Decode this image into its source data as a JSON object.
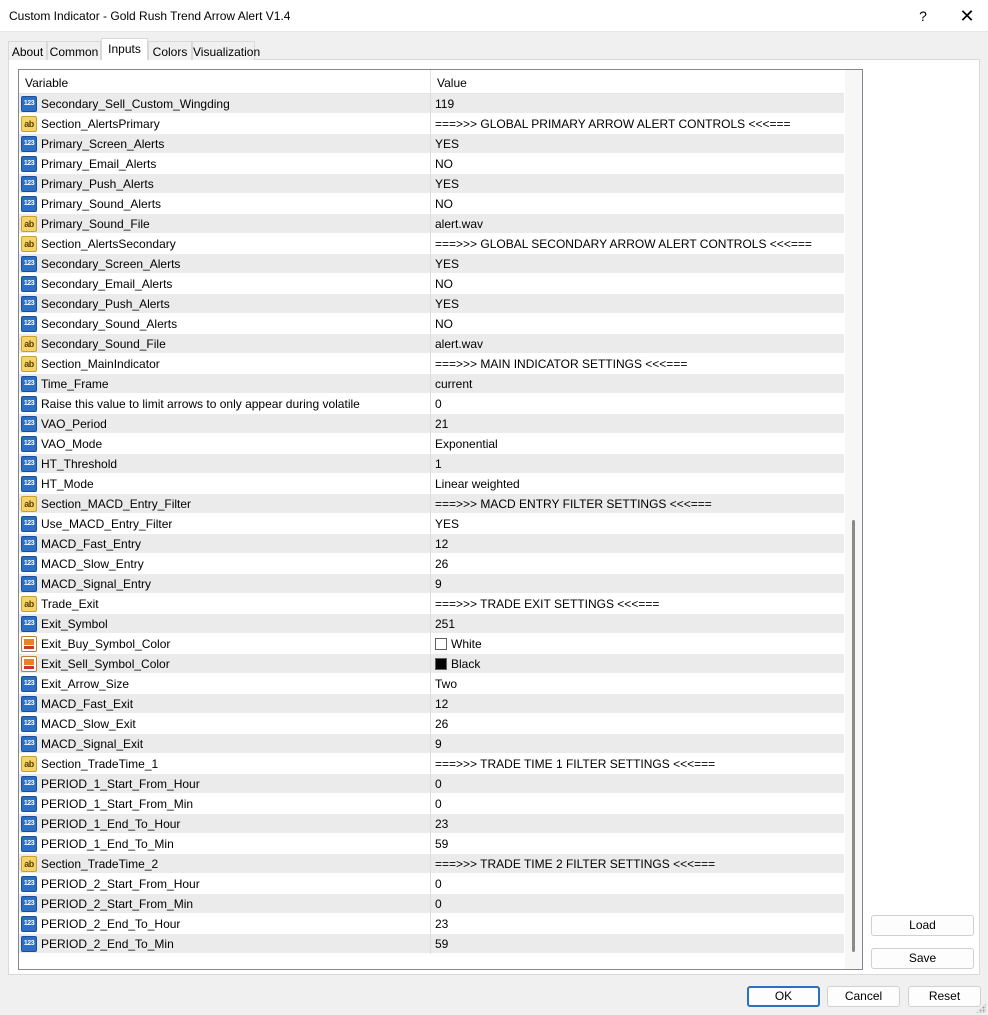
{
  "window": {
    "title": "Custom Indicator - Gold Rush Trend Arrow Alert V1.4",
    "help_label": "?",
    "close_label": "✕"
  },
  "tabs": [
    {
      "label": "About"
    },
    {
      "label": "Common"
    },
    {
      "label": "Inputs"
    },
    {
      "label": "Colors"
    },
    {
      "label": "Visualization"
    }
  ],
  "active_tab": "Inputs",
  "grid": {
    "header_variable": "Variable",
    "header_value": "Value"
  },
  "rows": [
    {
      "type": "num",
      "icon_text": "123",
      "variable": "Secondary_Sell_Custom_Wingding",
      "value": "119"
    },
    {
      "type": "str",
      "icon_text": "ab",
      "variable": "Section_AlertsPrimary",
      "value": "===>>> GLOBAL PRIMARY ARROW ALERT CONTROLS <<<==="
    },
    {
      "type": "num",
      "icon_text": "123",
      "variable": "Primary_Screen_Alerts",
      "value": "YES"
    },
    {
      "type": "num",
      "icon_text": "123",
      "variable": "Primary_Email_Alerts",
      "value": "NO"
    },
    {
      "type": "num",
      "icon_text": "123",
      "variable": "Primary_Push_Alerts",
      "value": "YES"
    },
    {
      "type": "num",
      "icon_text": "123",
      "variable": "Primary_Sound_Alerts",
      "value": "NO"
    },
    {
      "type": "str",
      "icon_text": "ab",
      "variable": "Primary_Sound_File",
      "value": "alert.wav"
    },
    {
      "type": "str",
      "icon_text": "ab",
      "variable": "Section_AlertsSecondary",
      "value": "===>>> GLOBAL SECONDARY ARROW ALERT CONTROLS <<<==="
    },
    {
      "type": "num",
      "icon_text": "123",
      "variable": "Secondary_Screen_Alerts",
      "value": "YES"
    },
    {
      "type": "num",
      "icon_text": "123",
      "variable": "Secondary_Email_Alerts",
      "value": "NO"
    },
    {
      "type": "num",
      "icon_text": "123",
      "variable": "Secondary_Push_Alerts",
      "value": "YES"
    },
    {
      "type": "num",
      "icon_text": "123",
      "variable": "Secondary_Sound_Alerts",
      "value": "NO"
    },
    {
      "type": "str",
      "icon_text": "ab",
      "variable": "Secondary_Sound_File",
      "value": "alert.wav"
    },
    {
      "type": "str",
      "icon_text": "ab",
      "variable": "Section_MainIndicator",
      "value": "===>>> MAIN INDICATOR SETTINGS <<<==="
    },
    {
      "type": "num",
      "icon_text": "123",
      "variable": "Time_Frame",
      "value": "current"
    },
    {
      "type": "num",
      "icon_text": "123",
      "variable": "Raise this value to limit arrows to only appear during volatile",
      "value": "0"
    },
    {
      "type": "num",
      "icon_text": "123",
      "variable": "VAO_Period",
      "value": "21"
    },
    {
      "type": "num",
      "icon_text": "123",
      "variable": "VAO_Mode",
      "value": "Exponential"
    },
    {
      "type": "num",
      "icon_text": "123",
      "variable": "HT_Threshold",
      "value": "1"
    },
    {
      "type": "num",
      "icon_text": "123",
      "variable": "HT_Mode",
      "value": "Linear weighted"
    },
    {
      "type": "str",
      "icon_text": "ab",
      "variable": "Section_MACD_Entry_Filter",
      "value": "===>>> MACD ENTRY FILTER SETTINGS <<<==="
    },
    {
      "type": "num",
      "icon_text": "123",
      "variable": "Use_MACD_Entry_Filter",
      "value": "YES"
    },
    {
      "type": "num",
      "icon_text": "123",
      "variable": "MACD_Fast_Entry",
      "value": "12"
    },
    {
      "type": "num",
      "icon_text": "123",
      "variable": "MACD_Slow_Entry",
      "value": "26"
    },
    {
      "type": "num",
      "icon_text": "123",
      "variable": "MACD_Signal_Entry",
      "value": "9"
    },
    {
      "type": "str",
      "icon_text": "ab",
      "variable": "Trade_Exit",
      "value": "===>>> TRADE EXIT SETTINGS <<<==="
    },
    {
      "type": "num",
      "icon_text": "123",
      "variable": "Exit_Symbol",
      "value": "251"
    },
    {
      "type": "color",
      "icon_text": "",
      "variable": "Exit_Buy_Symbol_Color",
      "value": "White",
      "swatch": "#ffffff"
    },
    {
      "type": "color",
      "icon_text": "",
      "variable": "Exit_Sell_Symbol_Color",
      "value": "Black",
      "swatch": "#000000"
    },
    {
      "type": "num",
      "icon_text": "123",
      "variable": "Exit_Arrow_Size",
      "value": "Two"
    },
    {
      "type": "num",
      "icon_text": "123",
      "variable": "MACD_Fast_Exit",
      "value": "12"
    },
    {
      "type": "num",
      "icon_text": "123",
      "variable": "MACD_Slow_Exit",
      "value": "26"
    },
    {
      "type": "num",
      "icon_text": "123",
      "variable": "MACD_Signal_Exit",
      "value": "9"
    },
    {
      "type": "str",
      "icon_text": "ab",
      "variable": "Section_TradeTime_1",
      "value": "===>>> TRADE TIME 1 FILTER SETTINGS <<<==="
    },
    {
      "type": "num",
      "icon_text": "123",
      "variable": "PERIOD_1_Start_From_Hour",
      "value": "0"
    },
    {
      "type": "num",
      "icon_text": "123",
      "variable": "PERIOD_1_Start_From_Min",
      "value": "0"
    },
    {
      "type": "num",
      "icon_text": "123",
      "variable": "PERIOD_1_End_To_Hour",
      "value": "23"
    },
    {
      "type": "num",
      "icon_text": "123",
      "variable": "PERIOD_1_End_To_Min",
      "value": "59"
    },
    {
      "type": "str",
      "icon_text": "ab",
      "variable": "Section_TradeTime_2",
      "value": "===>>> TRADE TIME 2 FILTER SETTINGS <<<==="
    },
    {
      "type": "num",
      "icon_text": "123",
      "variable": "PERIOD_2_Start_From_Hour",
      "value": "0"
    },
    {
      "type": "num",
      "icon_text": "123",
      "variable": "PERIOD_2_Start_From_Min",
      "value": "0"
    },
    {
      "type": "num",
      "icon_text": "123",
      "variable": "PERIOD_2_End_To_Hour",
      "value": "23"
    },
    {
      "type": "num",
      "icon_text": "123",
      "variable": "PERIOD_2_End_To_Min",
      "value": "59"
    }
  ],
  "buttons": {
    "load": "Load",
    "save": "Save",
    "ok": "OK",
    "cancel": "Cancel",
    "reset": "Reset"
  }
}
